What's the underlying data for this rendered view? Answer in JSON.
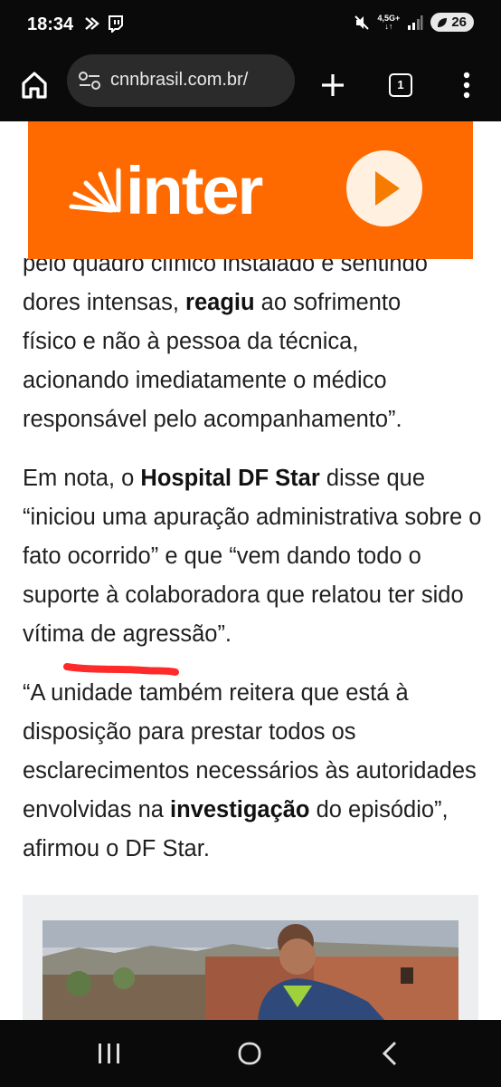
{
  "status_bar": {
    "time": "18:34",
    "network": "4,5G+",
    "battery": "26"
  },
  "browser": {
    "url": "cnnbrasil.com.br/",
    "tab_count": "1"
  },
  "ad": {
    "brand": "inter",
    "brand_color": "#ff6a00"
  },
  "article": {
    "p1_line1": "pelo quadro clínico instalado e sentindo",
    "p1_line2_pre": "dores intensas, ",
    "p1_line2_bold": "reagiu",
    "p1_line2_post": " ao sofrimento",
    "p1_line3": "físico e não à pessoa da técnica,",
    "p1_line4": "acionando imediatamente o médico",
    "p1_line5": "responsável pelo acompanhamento”.",
    "p2_pre": "Em nota, o ",
    "p2_bold": "Hospital DF Star",
    "p2_post": " disse que “iniciou uma apuração administrativa sobre o fato ocorrido” e que “vem dando todo o suporte à colaboradora que relatou ter sido vítima de agressão”.",
    "p3_pre": "“A unidade também reitera que está à disposição para prestar todos os esclarecimentos necessários às autoridades envolvidas na ",
    "p3_bold": "investigação",
    "p3_post": " do episódio”, afirmou o DF Star."
  },
  "annotation": {
    "underline_color": "#ff2a2a"
  }
}
